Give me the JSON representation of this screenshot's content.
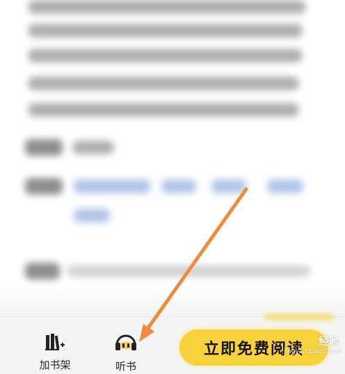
{
  "bottom_bar": {
    "add_shelf_label": "加书架",
    "listen_label": "听书",
    "read_button_label": "立即免费阅读"
  },
  "watermark": {
    "title": "经验",
    "url": "jingyan.baidu.com"
  },
  "colors": {
    "read_button": "#f7d23a",
    "arrow": "#f08a3c",
    "tag_blue": "#7fa0d8"
  },
  "icons": {
    "add_shelf": "bookshelf-plus-icon",
    "listen": "headphones-icon"
  }
}
